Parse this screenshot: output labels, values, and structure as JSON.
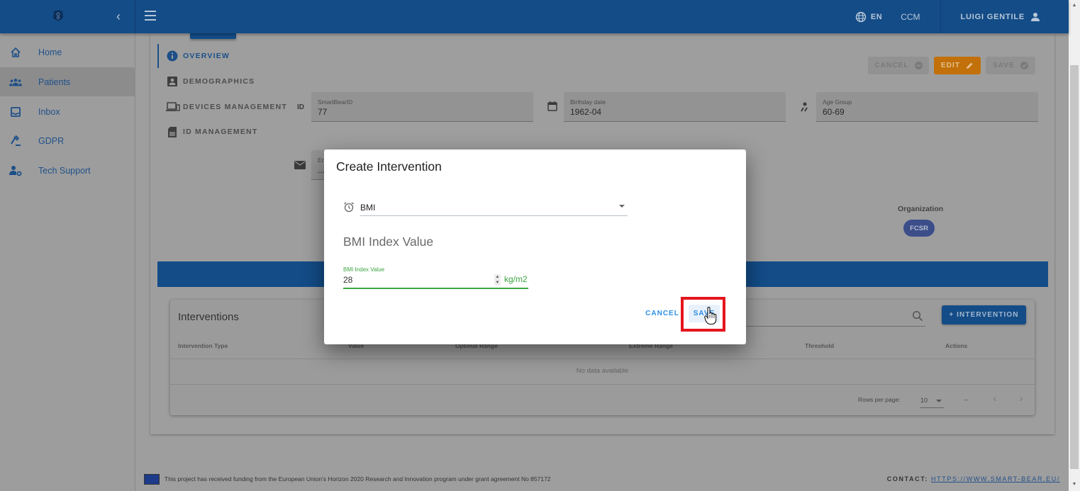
{
  "appbar": {
    "collapse_icon": "chevron-left-icon",
    "menu_icon": "hamburger-menu-icon",
    "language": "EN",
    "organization_code": "CCM",
    "user_name": "LUIGI GENTILE"
  },
  "sidebar": {
    "items": [
      {
        "label": "Home",
        "icon": "home-icon",
        "active": false
      },
      {
        "label": "Patients",
        "icon": "people-icon",
        "active": true
      },
      {
        "label": "Inbox",
        "icon": "inbox-icon",
        "active": false
      },
      {
        "label": "GDPR",
        "icon": "gavel-icon",
        "active": false
      },
      {
        "label": "Tech Support",
        "icon": "user-gear-icon",
        "active": false
      }
    ]
  },
  "patient_tabs": [
    {
      "label": "OVERVIEW",
      "icon": "info-icon",
      "active": true
    },
    {
      "label": "DEMOGRAPHICS",
      "icon": "contact-card-icon",
      "active": false
    },
    {
      "label": "DEVICES MANAGEMENT",
      "icon": "devices-icon",
      "active": false
    },
    {
      "label": "ID MANAGEMENT",
      "icon": "sim-card-icon",
      "active": false
    }
  ],
  "actions": {
    "cancel": "CANCEL",
    "edit": "EDIT",
    "save": "SAVE"
  },
  "fields": {
    "smartbear_id": {
      "label": "SmartBearID",
      "value": "77",
      "icon_text": "ID"
    },
    "birthday": {
      "label": "Birthday date",
      "value": "1962-04"
    },
    "age_group": {
      "label": "Age Group",
      "value": "60-69"
    },
    "email": {
      "label": "En",
      "value": "..."
    }
  },
  "organization": {
    "label": "Organization",
    "chip": "FCSR"
  },
  "interventions": {
    "title": "Interventions",
    "add_button": "+ INTERVENTION",
    "columns": [
      "Intervention Type",
      "Value",
      "Optimal Range",
      "Extreme Range",
      "Threshold",
      "Actions"
    ],
    "empty_text": "No data available",
    "rows_per_page_label": "Rows per page:",
    "rows_per_page": "10",
    "page_range": "–"
  },
  "dialog": {
    "title": "Create Intervention",
    "type_select": "BMI",
    "section_heading": "BMI Index Value",
    "value_field": {
      "label": "BMI Index Value",
      "value": "28",
      "unit": "kg/m2"
    },
    "cancel": "CANCEL",
    "save": "SAVE"
  },
  "footer": {
    "funding_text": "This project has received funding from the European Union's Horizon 2020 Research and Innovation program under grant agreement No 857172",
    "contact_label": "CONTACT:",
    "contact_link": "HTTPS://WWW.SMART-BEAR.EU/"
  },
  "colors": {
    "primary": "#134c87",
    "edit_orange": "#c2700a",
    "success_green": "#3da542",
    "link_blue": "#2c8ee6",
    "highlight_red": "#e5151d"
  }
}
